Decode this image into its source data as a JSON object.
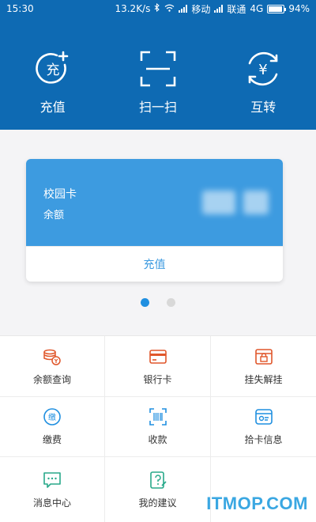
{
  "status_bar": {
    "time": "15:30",
    "speed": "13.2K/s",
    "carrier1": "移动",
    "carrier2": "联通",
    "network": "4G",
    "battery": "94%",
    "battery_level": 0.94
  },
  "header": {
    "actions": [
      {
        "label": "充值",
        "icon_text": "充",
        "icon": "recharge-icon"
      },
      {
        "label": "扫一扫",
        "icon": "scan-icon"
      },
      {
        "label": "互转",
        "icon_text": "¥",
        "icon": "transfer-icon"
      }
    ]
  },
  "card": {
    "title": "校园卡",
    "subtitle": "余额",
    "action_label": "充值"
  },
  "pagination": {
    "total": 2,
    "active": 0
  },
  "grid": {
    "items": [
      {
        "label": "余额查询",
        "icon": "balance-query-icon",
        "color": "#e0572b"
      },
      {
        "label": "银行卡",
        "icon": "bank-card-icon",
        "color": "#e0572b"
      },
      {
        "label": "挂失解挂",
        "icon": "lock-report-icon",
        "color": "#e0572b"
      },
      {
        "label": "缴费",
        "icon": "payment-icon",
        "icon_text": "缴",
        "color": "#1f8fe0"
      },
      {
        "label": "收款",
        "icon": "receive-barcode-icon",
        "color": "#1f8fe0"
      },
      {
        "label": "拾卡信息",
        "icon": "found-card-icon",
        "color": "#1f8fe0"
      },
      {
        "label": "消息中心",
        "icon": "message-center-icon",
        "color": "#28a98a"
      },
      {
        "label": "我的建议",
        "icon": "suggestion-icon",
        "color": "#28a98a"
      }
    ]
  },
  "watermark": "ITMOP.COM",
  "colors": {
    "header_blue": "#0e6ab3",
    "card_blue": "#3d9be0",
    "dot_active": "#1f8fe0"
  }
}
